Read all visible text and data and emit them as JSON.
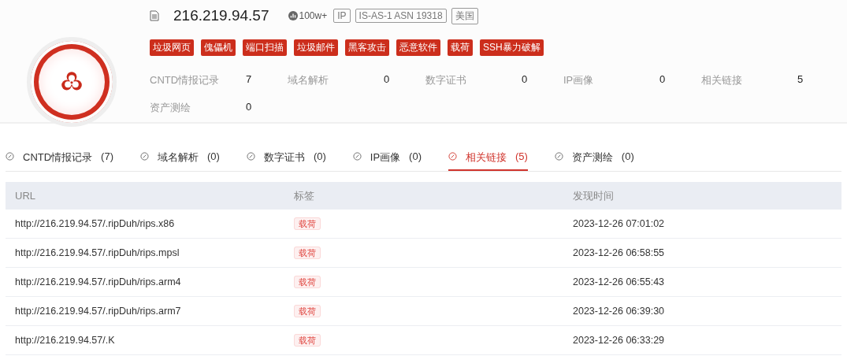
{
  "header": {
    "ip": "216.219.94.57",
    "rank": "100w+",
    "labels": [
      "IP",
      "IS-AS-1 ASN 19318",
      "美国"
    ],
    "threat_tags": [
      "垃圾网页",
      "傀儡机",
      "端口扫描",
      "垃圾邮件",
      "黑客攻击",
      "恶意软件",
      "载荷",
      "SSH暴力破解"
    ],
    "stats": [
      {
        "label": "CNTD情报记录",
        "value": "7"
      },
      {
        "label": "域名解析",
        "value": "0"
      },
      {
        "label": "数字证书",
        "value": "0"
      },
      {
        "label": "IP画像",
        "value": "0"
      },
      {
        "label": "相关链接",
        "value": "5"
      },
      {
        "label": "资产测绘",
        "value": "0"
      }
    ]
  },
  "tabs": [
    {
      "label": "CNTD情报记录",
      "count": "(7)",
      "selected": false
    },
    {
      "label": "域名解析",
      "count": "(0)",
      "selected": false
    },
    {
      "label": "数字证书",
      "count": "(0)",
      "selected": false
    },
    {
      "label": "IP画像",
      "count": "(0)",
      "selected": false
    },
    {
      "label": "相关链接",
      "count": "(5)",
      "selected": true
    },
    {
      "label": "资产测绘",
      "count": "(0)",
      "selected": false
    }
  ],
  "table": {
    "columns": [
      "URL",
      "标签",
      "发现时间"
    ],
    "rows": [
      {
        "url": "http://216.219.94.57/.ripDuh/rips.x86",
        "tag": "载荷",
        "time": "2023-12-26 07:01:02"
      },
      {
        "url": "http://216.219.94.57/.ripDuh/rips.mpsl",
        "tag": "载荷",
        "time": "2023-12-26 06:58:55"
      },
      {
        "url": "http://216.219.94.57/.ripDuh/rips.arm4",
        "tag": "载荷",
        "time": "2023-12-26 06:55:43"
      },
      {
        "url": "http://216.219.94.57/.ripDuh/rips.arm7",
        "tag": "载荷",
        "time": "2023-12-26 06:39:30"
      },
      {
        "url": "http://216.219.94.57/.K",
        "tag": "载荷",
        "time": "2023-12-26 06:33:29"
      }
    ]
  }
}
